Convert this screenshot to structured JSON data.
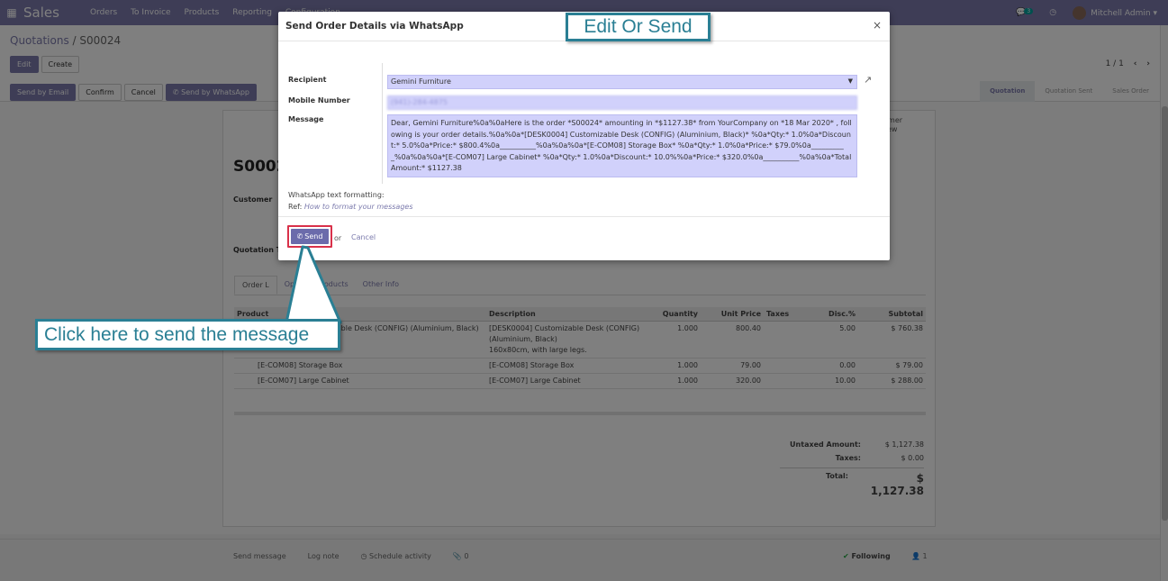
{
  "navbar": {
    "app_name": "Sales",
    "menu": [
      "Orders",
      "To Invoice",
      "Products",
      "Reporting",
      "Configuration"
    ],
    "chat_count": "3",
    "user_name": "Mitchell Admin"
  },
  "control": {
    "breadcrumb_parent": "Quotations",
    "breadcrumb_sep": " / ",
    "breadcrumb_current": "S00024",
    "edit_label": "Edit",
    "create_label": "Create",
    "pager": "1 / 1"
  },
  "statusbar": {
    "send_email_label": "Send by Email",
    "confirm_label": "Confirm",
    "cancel_label": "Cancel",
    "send_whatsapp_label": "Send by WhatsApp",
    "stages": [
      "Quotation",
      "Quotation Sent",
      "Sales Order"
    ]
  },
  "sheet": {
    "order_name": "S0002",
    "customer_label": "Customer",
    "quotation_label": "Quotation T",
    "customer_preview_line1": "tomer",
    "customer_preview_line2": "view",
    "tabs": [
      "Order L",
      "Optional Products",
      "Other Info"
    ],
    "columns": [
      "Product",
      "Description",
      "Quantity",
      "Unit Price",
      "Taxes",
      "Disc.%",
      "Subtotal"
    ],
    "lines": [
      {
        "product": "[DESK0004] Customizable Desk (CONFIG) (Aluminium, Black)",
        "description": [
          "[DESK0004] Customizable Desk (CONFIG)",
          "(Aluminium, Black)",
          "160x80cm, with large legs."
        ],
        "quantity": "1.000",
        "unit_price": "800.40",
        "taxes": "",
        "discount": "5.00",
        "subtotal": "$ 760.38"
      },
      {
        "product": "[E-COM08] Storage Box",
        "description": [
          "[E-COM08] Storage Box"
        ],
        "quantity": "1.000",
        "unit_price": "79.00",
        "taxes": "",
        "discount": "0.00",
        "subtotal": "$ 79.00"
      },
      {
        "product": "[E-COM07] Large Cabinet",
        "description": [
          "[E-COM07] Large Cabinet"
        ],
        "quantity": "1.000",
        "unit_price": "320.00",
        "taxes": "",
        "discount": "10.00",
        "subtotal": "$ 288.00"
      }
    ],
    "untaxed_label": "Untaxed Amount:",
    "untaxed_value": "$ 1,127.38",
    "taxes_label": "Taxes:",
    "taxes_value": "$ 0.00",
    "total_label": "Total:",
    "total_value": "$ 1,127.38"
  },
  "chatter": {
    "send_message": "Send message",
    "log_note": "Log note",
    "schedule_activity": "Schedule activity",
    "attachments": "0",
    "following": "Following",
    "followers": "1"
  },
  "modal": {
    "title": "Send Order Details via WhatsApp",
    "close": "×",
    "recipient_label": "Recipient",
    "recipient_value": "Gemini Furniture",
    "mobile_label": "Mobile Number",
    "mobile_value": "(941)-284-4875",
    "message_label": "Message",
    "message_value": "Dear, Gemini Furniture%0a%0aHere is the order *S00024* amounting in *$1127.38* from YourCompany on *18 Mar 2020* , following is your order details.%0a%0a*[DESK0004] Customizable Desk (CONFIG) (Aluminium, Black)* %0a*Qty:* 1.0%0a*Discount:* 5.0%0a*Price:* $800.4%0a__________%0a%0a%0a*[E-COM08] Storage Box* %0a*Qty:* 1.0%0a*Price:* $79.0%0a__________%0a%0a%0a*[E-COM07] Large Cabinet* %0a*Qty:* 1.0%0a*Discount:* 10.0%%0a*Price:* $320.0%0a__________%0a%0a*Total Amount:* $1127.38",
    "formatting_label": "WhatsApp text formatting:",
    "ref_label": "Ref:",
    "ref_link": "How to format your messages",
    "send_label": "Send",
    "or_label": "or",
    "cancel_label": "Cancel"
  },
  "annotations": {
    "top": "Edit Or Send",
    "bottom": "Click here to send the message"
  },
  "colors": {
    "brand": "#7c7bad",
    "field_bg": "#d1d1fb",
    "callout": "#2a7f94",
    "highlight": "#d9314a"
  }
}
